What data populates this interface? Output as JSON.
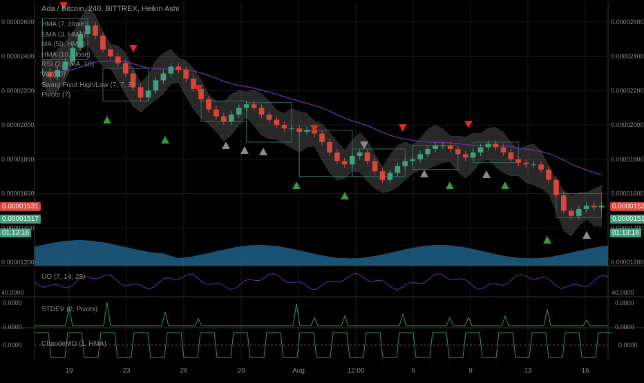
{
  "header": {
    "title": "Ada / Bitcoin, 240, BITTREX, Heikin Ashi"
  },
  "studies": [
    "HMA (7, close)",
    "EMA (3, HMA)",
    "MA (50, HMA)",
    "HMA (10, close)",
    "RSI (2, HMA, 10)",
    "Vol (20)",
    "Swing Pivot High/Low (7, 7, 3)",
    "Pivots (7)"
  ],
  "price_axis": {
    "ticks": [
      "0.00002600",
      "0.00002400",
      "0.00002200",
      "0.00002000",
      "0.00001800",
      "0.00001600",
      "0.00001400",
      "0.00001200"
    ],
    "last_price_tag": "0.00001531",
    "prev_price_tag": "0.00001517",
    "countdown": "01:13:16"
  },
  "sub_panes": {
    "uo": {
      "label": "UO (7, 14, 28)",
      "value_left": "40.0000",
      "value_right": "40.0000"
    },
    "stdev": {
      "label": "STDEV (2, Pivots)",
      "top_value": "0.0000",
      "bottom_value": "0.0000"
    },
    "cmo": {
      "label": "ChandeMO (1, HMA)",
      "value": "0.0000"
    }
  },
  "time_axis": [
    "19",
    "23",
    "26",
    "29",
    "Aug",
    "12:00",
    "6",
    "9",
    "13",
    "16"
  ],
  "colors": {
    "background": "#000000",
    "grid": "#1b1b1b",
    "up_candle": "#3ea07c",
    "down_candle": "#d9453b",
    "ma_line": "#6e2fa8",
    "band": "#5a5a5a",
    "volume": "#1e5f86",
    "pivot_high": "#e02828",
    "pivot_low": "#3a9a3a",
    "pivot_neutral": "#8c8c8c",
    "pivot_box": "#2f6e6a",
    "uo_line": "#6e2fa8",
    "stdev_line": "#2f9a5a",
    "cmo_line": "#2f9a5a",
    "tag_red": "#d9453b",
    "tag_green": "#3ea07c"
  },
  "chart_data": {
    "type": "candlestick",
    "ylim": [
      1.18e-05,
      2.72e-05
    ],
    "close": [
      2.31,
      2.28,
      2.32,
      2.37,
      2.45,
      2.53,
      2.58,
      2.52,
      2.44,
      2.4,
      2.36,
      2.3,
      2.22,
      2.16,
      2.2,
      2.26,
      2.3,
      2.34,
      2.32,
      2.27,
      2.21,
      2.15,
      2.09,
      2.05,
      2.02,
      2.06,
      2.1,
      2.12,
      2.1,
      2.06,
      2.03,
      2.0,
      1.98,
      1.98,
      1.96,
      1.97,
      1.95,
      1.9,
      1.84,
      1.79,
      1.77,
      1.82,
      1.84,
      1.79,
      1.73,
      1.68,
      1.72,
      1.76,
      1.79,
      1.8,
      1.83,
      1.86,
      1.88,
      1.88,
      1.86,
      1.83,
      1.81,
      1.84,
      1.87,
      1.89,
      1.87,
      1.84,
      1.8,
      1.78,
      1.77,
      1.77,
      1.74,
      1.68,
      1.59,
      1.5,
      1.47,
      1.51,
      1.53,
      1.52,
      1.53
    ]
  }
}
